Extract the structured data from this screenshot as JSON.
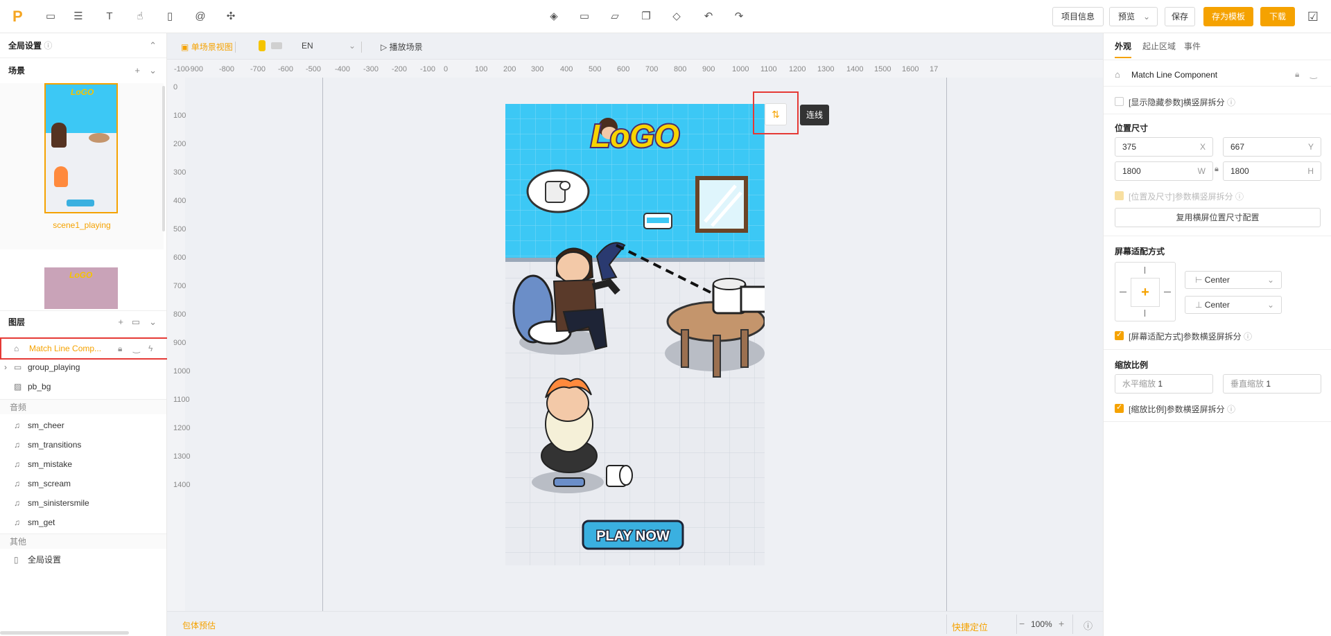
{
  "topbar": {
    "project_info": "项目信息",
    "preview": "预览",
    "save": "保存",
    "save_template": "存为模板",
    "download": "下载"
  },
  "left": {
    "global_settings": "全局设置",
    "scenes_title": "场景",
    "scene1_name": "scene1_playing",
    "layers_title": "图层",
    "layers": [
      "Match Line Comp...",
      "group_playing",
      "pb_bg"
    ],
    "audio_title": "音频",
    "audio": [
      "sm_cheer",
      "sm_transitions",
      "sm_mistake",
      "sm_scream",
      "sm_sinistersmile",
      "sm_get"
    ],
    "other_title": "其他",
    "other_global": "全局设置"
  },
  "canvas": {
    "single_scene_view": "单场景视图",
    "lang": "EN",
    "play_scene": "播放场景",
    "ruler_top": [
      "-100",
      "-900",
      "-800",
      "-700",
      "-600",
      "-500",
      "-400",
      "-300",
      "-200",
      "-100",
      "0",
      "100",
      "200",
      "300",
      "400",
      "500",
      "600",
      "700",
      "800",
      "900",
      "1000",
      "1100",
      "1200",
      "1300",
      "1400",
      "1500",
      "1600",
      "17"
    ],
    "ruler_left": [
      "0",
      "100",
      "200",
      "300",
      "400",
      "500",
      "600",
      "700",
      "800",
      "900",
      "1000",
      "1100",
      "1200",
      "1300",
      "1400"
    ],
    "tooltip": "连线",
    "size_estimate": "包体预估",
    "quick_locate": "快捷定位",
    "zoom": "100%",
    "logo_text": "LoGO",
    "cta": "PLAY NOW"
  },
  "right": {
    "tabs": [
      "外观",
      "起止区域",
      "事件"
    ],
    "component_name": "Match Line Component",
    "show_hidden": "[显示隐藏参数]横竖屏拆分",
    "pos_size_title": "位置尺寸",
    "x_val": "375",
    "x_label": "X",
    "y_val": "667",
    "y_label": "Y",
    "w_val": "1800",
    "w_label": "W",
    "h_val": "1800",
    "h_label": "H",
    "pos_split": "[位置及尺寸]参数横竖屏拆分",
    "reuse_btn": "复用横屏位置尺寸配置",
    "adapt_title": "屏幕适配方式",
    "h_align": "Center",
    "v_align": "Center",
    "adapt_split": "[屏幕适配方式]参数横竖屏拆分",
    "scale_title": "缩放比例",
    "h_scale_label": "水平缩放",
    "h_scale": "1",
    "v_scale_label": "垂直缩放",
    "v_scale": "1",
    "scale_split": "[缩放比例]参数横竖屏拆分"
  },
  "colors": {
    "accent": "#f5a200",
    "highlight": "#e53935",
    "sky": "#3cc8f5"
  }
}
